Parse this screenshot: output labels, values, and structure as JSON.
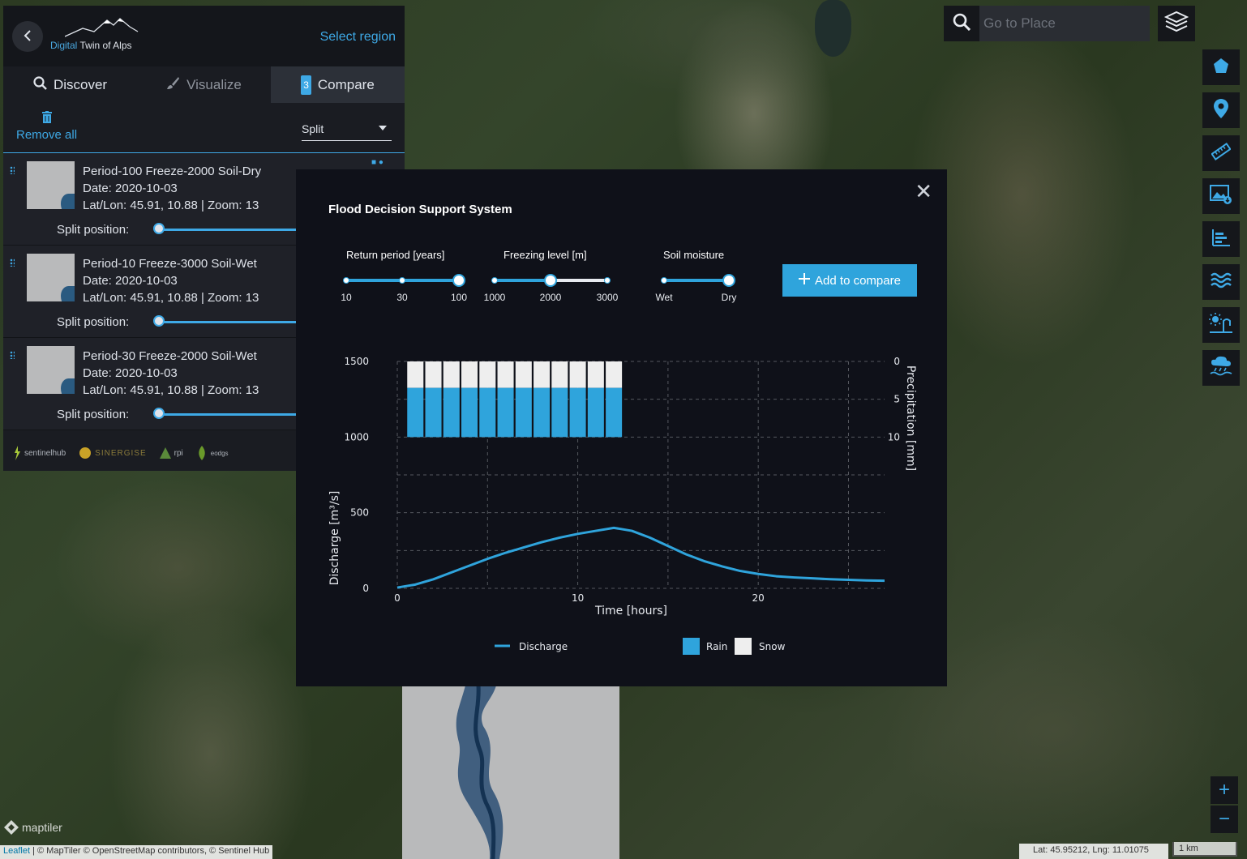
{
  "app": {
    "logo_prefix": "Digital",
    "logo_suffix": "Twin of Alps",
    "select_region": "Select region"
  },
  "tabs": [
    {
      "label": "Discover",
      "icon": "search-icon"
    },
    {
      "label": "Visualize",
      "icon": "brush-icon"
    },
    {
      "label": "Compare",
      "count": "3"
    }
  ],
  "toolbar": {
    "remove_all": "Remove all",
    "mode_value": "Split"
  },
  "compare_items": [
    {
      "title": "Period-100 Freeze-2000 Soil-Dry",
      "date": "Date: 2020-10-03",
      "location": "Lat/Lon: 45.91, 10.88 | Zoom: 13",
      "split_label": "Split position:"
    },
    {
      "title": "Period-10 Freeze-3000 Soil-Wet",
      "date": "Date: 2020-10-03",
      "location": "Lat/Lon: 45.91, 10.88 | Zoom: 13",
      "split_label": "Split position:"
    },
    {
      "title": "Period-30 Freeze-2000 Soil-Wet",
      "date": "Date: 2020-10-03",
      "location": "Lat/Lon: 45.91, 10.88 | Zoom: 13",
      "split_label": "Split position:"
    }
  ],
  "footer_logos": [
    "sentinelhub",
    "SINERGISE",
    "rpi",
    "eodgs"
  ],
  "modal": {
    "title": "Flood Decision Support System",
    "close_icon": "close-icon",
    "controls": {
      "return_period": {
        "label": "Return period [years]",
        "ticks": [
          "10",
          "30",
          "100"
        ],
        "selected": "100"
      },
      "freezing_level": {
        "label": "Freezing level [m]",
        "ticks": [
          "1000",
          "2000",
          "3000"
        ],
        "selected": "2000"
      },
      "soil_moisture": {
        "label": "Soil moisture",
        "ticks": [
          "Wet",
          "Dry"
        ],
        "selected": "Dry"
      }
    },
    "add_button": "Add to compare"
  },
  "chart_data": {
    "type": "line",
    "xlabel": "Time [hours]",
    "ylabel": "Discharge [m³/s]",
    "y2label": "Precipitation [mm]",
    "xlim": [
      0,
      27
    ],
    "ylim": [
      0,
      1500
    ],
    "y2lim": [
      0,
      30
    ],
    "x_ticks": [
      "0",
      "10",
      "20"
    ],
    "y_ticks": [
      "0",
      "500",
      "1000",
      "1500"
    ],
    "y2_ticks": [
      "0",
      "5",
      "10"
    ],
    "grid": true,
    "legend": [
      {
        "name": "Discharge",
        "color": "#2fa4dc",
        "kind": "line"
      },
      {
        "name": "Rain",
        "color": "#2fa4dc",
        "kind": "box"
      },
      {
        "name": "Snow",
        "color": "#eeeeee",
        "kind": "box"
      }
    ],
    "series": [
      {
        "name": "Discharge",
        "x": [
          0,
          1,
          2,
          3,
          4,
          5,
          6,
          7,
          8,
          9,
          10,
          11,
          12,
          13,
          14,
          15,
          16,
          17,
          18,
          19,
          20,
          21,
          22,
          23,
          24,
          25,
          26,
          27
        ],
        "values": [
          5,
          25,
          60,
          105,
          150,
          195,
          235,
          270,
          305,
          335,
          360,
          380,
          400,
          380,
          335,
          280,
          225,
          180,
          145,
          115,
          95,
          80,
          72,
          66,
          60,
          56,
          52,
          50
        ]
      }
    ],
    "precipitation": {
      "x": [
        1,
        2,
        3,
        4,
        5,
        6,
        7,
        8,
        9,
        10,
        11,
        12
      ],
      "snow": [
        3.5,
        3.5,
        3.5,
        3.5,
        3.5,
        3.5,
        3.5,
        3.5,
        3.5,
        3.5,
        3.5,
        3.5
      ],
      "rain": [
        6.5,
        6.5,
        6.5,
        6.5,
        6.5,
        6.5,
        6.5,
        6.5,
        6.5,
        6.5,
        6.5,
        6.5
      ]
    }
  },
  "search": {
    "placeholder": "Go to Place"
  },
  "side_tools": [
    "polygon-icon",
    "map-pin-icon",
    "ruler-icon",
    "image-download-icon",
    "bar-chart-icon",
    "waves-icon",
    "weather-icon",
    "rain-icon"
  ],
  "zoom": {
    "in": "+",
    "out": "−"
  },
  "attribution": {
    "leaflet": "Leaflet",
    "rest": " | © MapTiler © OpenStreetMap contributors, © Sentinel Hub"
  },
  "maptiler": "maptiler",
  "coords": "Lat: 45.95212, Lng: 11.01075",
  "scale": "1 km"
}
